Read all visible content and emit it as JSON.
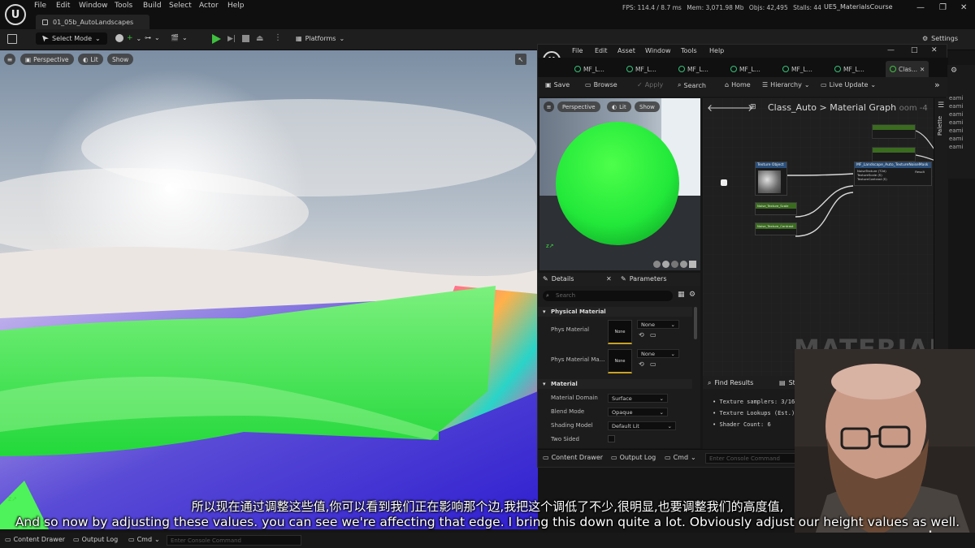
{
  "editor": {
    "menu": [
      "File",
      "Edit",
      "Window",
      "Tools",
      "Build",
      "Select",
      "Actor",
      "Help"
    ],
    "level_tab": "01_05b_AutoLandscapes",
    "stats": {
      "fps": "FPS: 114.4",
      "ms": "/ 8.7 ms",
      "mem": "Mem: 3,071.98 Mb",
      "objs": "Objs: 42,495",
      "stalls": "Stalls: 44"
    },
    "project": "UE5_MaterialsCourse",
    "toolbar": {
      "mode": "Select Mode",
      "platforms": "Platforms",
      "settings": "Settings"
    },
    "viewport": {
      "perspective": "Perspective",
      "lit": "Lit",
      "show": "Show"
    },
    "statusbar": {
      "content_drawer": "Content Drawer",
      "output_log": "Output Log",
      "cmd": "Cmd",
      "console_placeholder": "Enter Console Command"
    }
  },
  "material_editor": {
    "menu": [
      "File",
      "Edit",
      "Asset",
      "Window",
      "Tools",
      "Help"
    ],
    "tabs": [
      "MF_L...",
      "MF_L...",
      "MF_L...",
      "MF_L...",
      "MF_L...",
      "MF_L...",
      "Clas..."
    ],
    "toolbar": [
      "Save",
      "Browse",
      "Apply",
      "Search",
      "Home",
      "Hierarchy",
      "Live Update"
    ],
    "preview": {
      "perspective": "Perspective",
      "lit": "Lit",
      "show": "Show"
    },
    "breadcrumb": {
      "asset": "Class_Auto",
      "graph": "Material Graph",
      "zoom": "oom -4"
    },
    "graph_watermark": "MATERIAL",
    "graph_nodes": {
      "texture_object": "Texture Object",
      "function_call": "MF_Landscape_Auto_TextureNoiseMask",
      "inputs": [
        "NoiseTexture (T2d)",
        "TextureScale (S)",
        "TextureContrast (S)"
      ],
      "output": "Result",
      "param_scale": "Noise_Texture_Scale",
      "param_contrast": "Noise_Texture_Contrast"
    },
    "details": {
      "tab_details": "Details",
      "tab_parameters": "Parameters",
      "search_placeholder": "Search",
      "section_physical": "Physical Material",
      "phys_material": "Phys Material",
      "phys_material_map": "Phys Material Ma...",
      "none": "None",
      "section_material": "Material",
      "material_domain_label": "Material Domain",
      "material_domain_value": "Surface",
      "blend_mode_label": "Blend Mode",
      "blend_mode_value": "Opaque",
      "shading_model_label": "Shading Model",
      "shading_model_value": "Default Lit",
      "two_sided_label": "Two Sided"
    },
    "find_results": {
      "tab_find": "Find Results",
      "tab_stats": "Stats",
      "lines": [
        "Texture samplers: 3/16",
        "Texture Lookups (Est.): VS(",
        "Shader Count: 6"
      ]
    },
    "bottom": {
      "content_drawer": "Content Drawer",
      "output_log": "Output Log",
      "cmd": "Cmd",
      "console_placeholder": "Enter Console Command",
      "trailing": "ntrol"
    },
    "palette": "Palette",
    "side_items": [
      "eami",
      "eami",
      "eami",
      "eami",
      "eami",
      "eami",
      "eami"
    ]
  },
  "subtitles": {
    "zh": "所以现在通过调整这些值,你可以看到我们正在影响那个边,我把这个调低了不少,很明显,也要调整我们的高度值,",
    "en": "And so now by adjusting these values. you can see we're affecting that edge. I bring this down quite a lot. Obviously adjust our height values as well."
  },
  "watermark": "udemy",
  "colors": {
    "sphere": "#22e83a",
    "node_green": "#3a6b1f",
    "play_green": "#3fbf3f",
    "node_blue": "#2a4f7a"
  }
}
